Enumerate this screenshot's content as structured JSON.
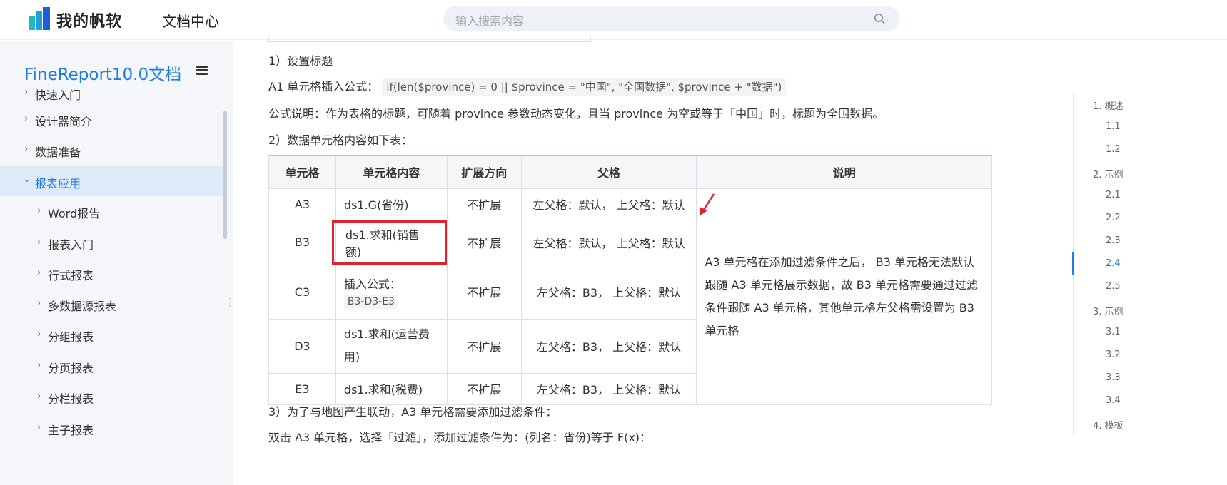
{
  "header": {
    "brand": "我的帆软",
    "doc_center": "文档中心",
    "search_placeholder": "输入搜索内容"
  },
  "sidebar": {
    "title": "FineReport10.0文档",
    "items": [
      {
        "label": "快速入门",
        "level": 1
      },
      {
        "label": "设计器简介",
        "level": 1
      },
      {
        "label": "数据准备",
        "level": 1
      },
      {
        "label": "报表应用",
        "level": 1,
        "active": true,
        "expanded": true
      },
      {
        "label": "Word报告",
        "level": 2
      },
      {
        "label": "报表入门",
        "level": 2
      },
      {
        "label": "行式报表",
        "level": 2
      },
      {
        "label": "多数据源报表",
        "level": 2
      },
      {
        "label": "分组报表",
        "level": 2
      },
      {
        "label": "分页报表",
        "level": 2
      },
      {
        "label": "分栏报表",
        "level": 2
      },
      {
        "label": "主子报表",
        "level": 2
      }
    ]
  },
  "content": {
    "step1": "1）设置标题",
    "a1_prefix": "A1 单元格插入公式：",
    "a1_formula": "if(len($province) = 0 || $province = \"中国\", \"全国数据\", $province + \"数据\")",
    "formula_note": "公式说明：作为表格的标题，可随着 province 参数动态变化，且当 province 为空或等于「中国」时，标题为全国数据。",
    "step2": "2）数据单元格内容如下表：",
    "table": {
      "headers": [
        "单元格",
        "单元格内容",
        "扩展方向",
        "父格",
        "说明"
      ],
      "rows": [
        {
          "cell": "A3",
          "content": "ds1.G(省份)",
          "direction": "不扩展",
          "parent": "左父格：默认， 上父格：默认"
        },
        {
          "cell": "B3",
          "content": "ds1.求和(销售额)",
          "direction": "不扩展",
          "parent": "左父格：默认， 上父格：默认",
          "highlighted": true
        },
        {
          "cell": "C3",
          "content": "插入公式：",
          "content_code": "B3-D3-E3",
          "direction": "不扩展",
          "parent": "左父格：B3， 上父格：默认"
        },
        {
          "cell": "D3",
          "content": "ds1.求和(运营费用)",
          "direction": "不扩展",
          "parent": "左父格：B3， 上父格：默认"
        },
        {
          "cell": "E3",
          "content": "ds1.求和(税费)",
          "direction": "不扩展",
          "parent": "左父格：B3， 上父格：默认"
        }
      ],
      "description": "A3 单元格在添加过滤条件之后， B3 单元格无法默认跟随 A3 单元格展示数据，故 B3 单元格需要通过过滤条件跟随 A3 单元格，其他单元格左父格需设置为 B3 单元格"
    },
    "step3": "3）为了与地图产生联动，A3 单元格需要添加过滤条件：",
    "step3_detail": "双击 A3 单元格，选择「过滤」，添加过滤条件为：(列名：省份)等于 F(x)："
  },
  "toc": {
    "items": [
      "1. 概述",
      "1.1",
      "1.2",
      "2. 示例",
      "2.1",
      "2.2",
      "2.3",
      "2.4",
      "2.5",
      "3. 示例",
      "3.1",
      "3.2",
      "3.3",
      "3.4",
      "4. 模板"
    ],
    "active_index": 7
  },
  "colors": {
    "accent": "#1e7ce6",
    "highlight_box": "#e0232e",
    "logo_teal": "#1fb8c4",
    "logo_blue": "#1d5fd6"
  }
}
